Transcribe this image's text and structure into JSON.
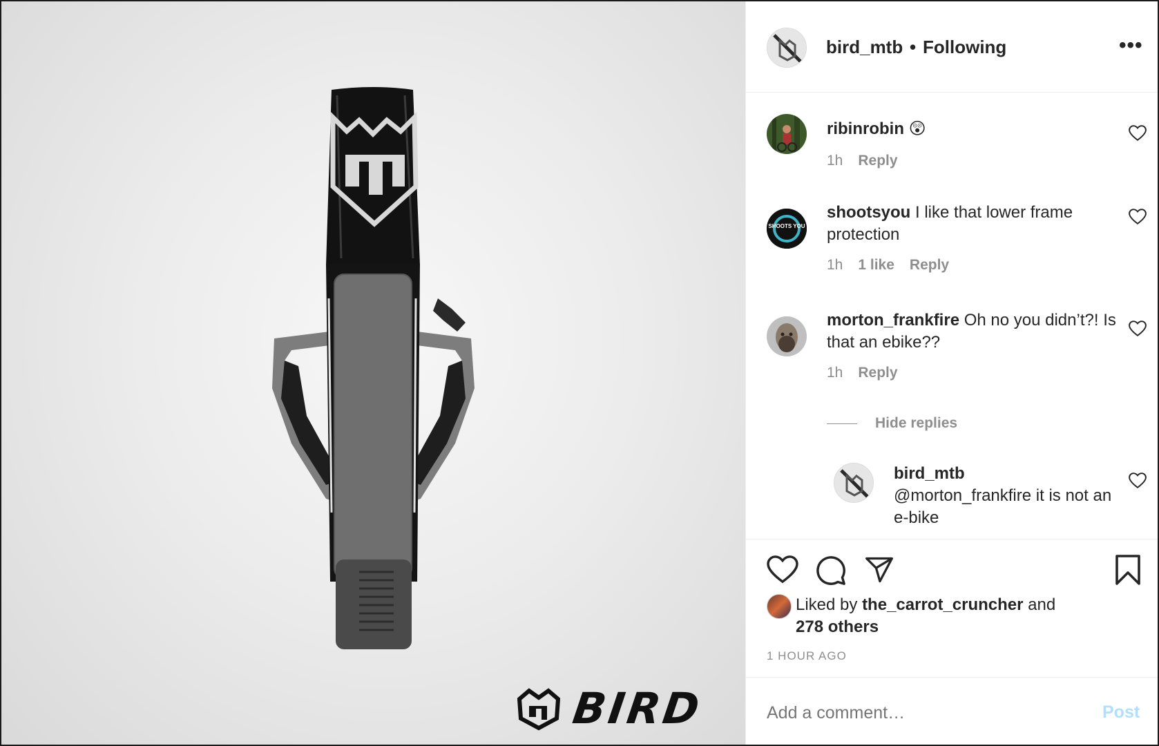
{
  "post": {
    "username": "bird_mtb",
    "separator": "•",
    "follow_status": "Following",
    "more_icon": "more-horizontal-icon"
  },
  "media": {
    "brand_text": "BIRD",
    "colors": {
      "background": "#ececec",
      "frame_black": "#111111",
      "guard_grey": "#7a7a7a"
    }
  },
  "comments": [
    {
      "username": "ribinrobin",
      "text": "😲",
      "time": "1h",
      "likes": "",
      "reply_label": "Reply"
    },
    {
      "username": "shootsyou",
      "text": "I like that lower frame protection",
      "time": "1h",
      "likes": "1 like",
      "reply_label": "Reply",
      "avatar_text": "SHOOTS YOU"
    },
    {
      "username": "morton_frankfire",
      "text": "Oh no you didn’t?! Is that an ebike??",
      "time": "1h",
      "likes": "",
      "reply_label": "Reply"
    }
  ],
  "hide_replies_label": "Hide replies",
  "reply": {
    "username": "bird_mtb",
    "text": "@morton_frankfire it is not an e-bike"
  },
  "likes": {
    "prefix": "Liked by",
    "liker": "the_carrot_cruncher",
    "conjunction": "and",
    "others": "278 others"
  },
  "time_ago": "1 HOUR AGO",
  "composer": {
    "placeholder": "Add a comment…",
    "post_label": "Post"
  },
  "colors": {
    "text": "#262626",
    "secondary": "#8e8e8e",
    "post_disabled": "#b2dffc",
    "border": "#efefef"
  }
}
